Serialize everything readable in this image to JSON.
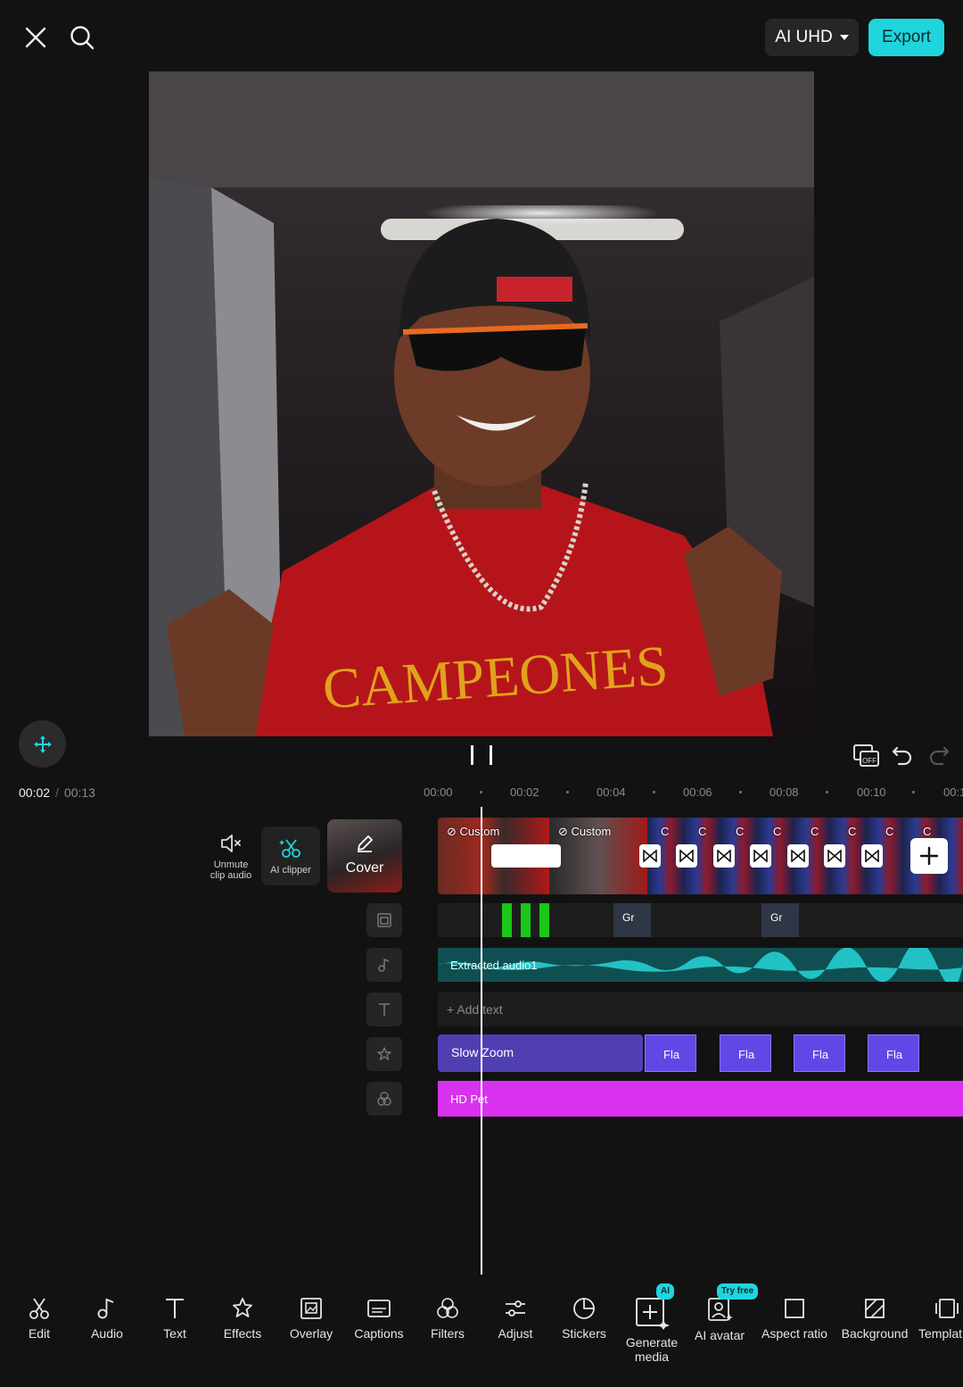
{
  "header": {
    "quality_label": "AI UHD",
    "export_label": "Export"
  },
  "playback": {
    "current_time": "00:02",
    "separator": "/",
    "total_time": "00:13"
  },
  "ruler": {
    "ticks": [
      "00:00",
      "00:02",
      "00:04",
      "00:06",
      "00:08",
      "00:10",
      "00:1"
    ]
  },
  "side_tools": {
    "unmute_label": "Unmute clip audio",
    "ai_clipper_label": "AI clipper",
    "cover_label": "Cover"
  },
  "tracks": {
    "video_clip_1": "Custom",
    "video_clip_2": "Custom",
    "video_clip_short": [
      "C",
      "C",
      "C",
      "C",
      "C",
      "C",
      "C",
      "C"
    ],
    "overlay_clips": [
      "Gr",
      "Gr"
    ],
    "audio_label": "Extracted audio1",
    "text_placeholder": "Add text",
    "effect_main": "Slow Zoom",
    "effect_segments": [
      "Fla",
      "Fla",
      "Fla",
      "Fla"
    ],
    "filter_label": "HD Pet"
  },
  "toolbar": {
    "items": [
      "Edit",
      "Audio",
      "Text",
      "Effects",
      "Overlay",
      "Captions",
      "Filters",
      "Adjust",
      "Stickers",
      "Generate media",
      "AI avatar",
      "Aspect ratio",
      "Background",
      "Templat"
    ],
    "badge_ai": "AI",
    "badge_try": "Try free"
  },
  "colors": {
    "accent": "#1fd5dd",
    "audio_track": "#0f4f52",
    "effect_track": "#4f3fb3",
    "filter_track": "#d932ee",
    "marker": "#19c619"
  }
}
